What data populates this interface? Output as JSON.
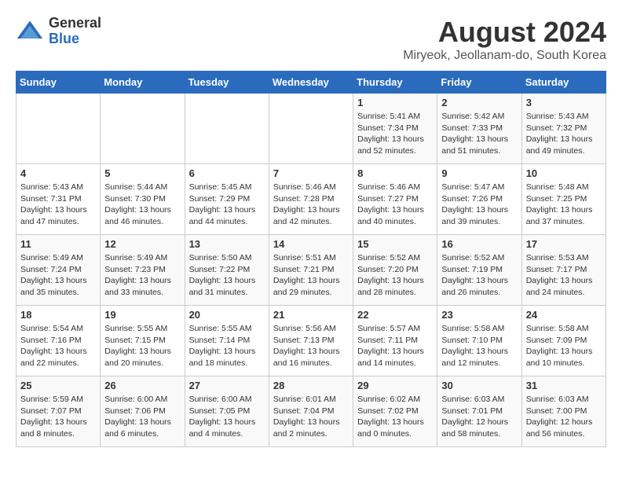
{
  "logo": {
    "general": "General",
    "blue": "Blue"
  },
  "title": "August 2024",
  "location": "Miryeok, Jeollanam-do, South Korea",
  "headers": [
    "Sunday",
    "Monday",
    "Tuesday",
    "Wednesday",
    "Thursday",
    "Friday",
    "Saturday"
  ],
  "weeks": [
    [
      {
        "day": "",
        "info": ""
      },
      {
        "day": "",
        "info": ""
      },
      {
        "day": "",
        "info": ""
      },
      {
        "day": "",
        "info": ""
      },
      {
        "day": "1",
        "info": "Sunrise: 5:41 AM\nSunset: 7:34 PM\nDaylight: 13 hours\nand 52 minutes."
      },
      {
        "day": "2",
        "info": "Sunrise: 5:42 AM\nSunset: 7:33 PM\nDaylight: 13 hours\nand 51 minutes."
      },
      {
        "day": "3",
        "info": "Sunrise: 5:43 AM\nSunset: 7:32 PM\nDaylight: 13 hours\nand 49 minutes."
      }
    ],
    [
      {
        "day": "4",
        "info": "Sunrise: 5:43 AM\nSunset: 7:31 PM\nDaylight: 13 hours\nand 47 minutes."
      },
      {
        "day": "5",
        "info": "Sunrise: 5:44 AM\nSunset: 7:30 PM\nDaylight: 13 hours\nand 46 minutes."
      },
      {
        "day": "6",
        "info": "Sunrise: 5:45 AM\nSunset: 7:29 PM\nDaylight: 13 hours\nand 44 minutes."
      },
      {
        "day": "7",
        "info": "Sunrise: 5:46 AM\nSunset: 7:28 PM\nDaylight: 13 hours\nand 42 minutes."
      },
      {
        "day": "8",
        "info": "Sunrise: 5:46 AM\nSunset: 7:27 PM\nDaylight: 13 hours\nand 40 minutes."
      },
      {
        "day": "9",
        "info": "Sunrise: 5:47 AM\nSunset: 7:26 PM\nDaylight: 13 hours\nand 39 minutes."
      },
      {
        "day": "10",
        "info": "Sunrise: 5:48 AM\nSunset: 7:25 PM\nDaylight: 13 hours\nand 37 minutes."
      }
    ],
    [
      {
        "day": "11",
        "info": "Sunrise: 5:49 AM\nSunset: 7:24 PM\nDaylight: 13 hours\nand 35 minutes."
      },
      {
        "day": "12",
        "info": "Sunrise: 5:49 AM\nSunset: 7:23 PM\nDaylight: 13 hours\nand 33 minutes."
      },
      {
        "day": "13",
        "info": "Sunrise: 5:50 AM\nSunset: 7:22 PM\nDaylight: 13 hours\nand 31 minutes."
      },
      {
        "day": "14",
        "info": "Sunrise: 5:51 AM\nSunset: 7:21 PM\nDaylight: 13 hours\nand 29 minutes."
      },
      {
        "day": "15",
        "info": "Sunrise: 5:52 AM\nSunset: 7:20 PM\nDaylight: 13 hours\nand 28 minutes."
      },
      {
        "day": "16",
        "info": "Sunrise: 5:52 AM\nSunset: 7:19 PM\nDaylight: 13 hours\nand 26 minutes."
      },
      {
        "day": "17",
        "info": "Sunrise: 5:53 AM\nSunset: 7:17 PM\nDaylight: 13 hours\nand 24 minutes."
      }
    ],
    [
      {
        "day": "18",
        "info": "Sunrise: 5:54 AM\nSunset: 7:16 PM\nDaylight: 13 hours\nand 22 minutes."
      },
      {
        "day": "19",
        "info": "Sunrise: 5:55 AM\nSunset: 7:15 PM\nDaylight: 13 hours\nand 20 minutes."
      },
      {
        "day": "20",
        "info": "Sunrise: 5:55 AM\nSunset: 7:14 PM\nDaylight: 13 hours\nand 18 minutes."
      },
      {
        "day": "21",
        "info": "Sunrise: 5:56 AM\nSunset: 7:13 PM\nDaylight: 13 hours\nand 16 minutes."
      },
      {
        "day": "22",
        "info": "Sunrise: 5:57 AM\nSunset: 7:11 PM\nDaylight: 13 hours\nand 14 minutes."
      },
      {
        "day": "23",
        "info": "Sunrise: 5:58 AM\nSunset: 7:10 PM\nDaylight: 13 hours\nand 12 minutes."
      },
      {
        "day": "24",
        "info": "Sunrise: 5:58 AM\nSunset: 7:09 PM\nDaylight: 13 hours\nand 10 minutes."
      }
    ],
    [
      {
        "day": "25",
        "info": "Sunrise: 5:59 AM\nSunset: 7:07 PM\nDaylight: 13 hours\nand 8 minutes."
      },
      {
        "day": "26",
        "info": "Sunrise: 6:00 AM\nSunset: 7:06 PM\nDaylight: 13 hours\nand 6 minutes."
      },
      {
        "day": "27",
        "info": "Sunrise: 6:00 AM\nSunset: 7:05 PM\nDaylight: 13 hours\nand 4 minutes."
      },
      {
        "day": "28",
        "info": "Sunrise: 6:01 AM\nSunset: 7:04 PM\nDaylight: 13 hours\nand 2 minutes."
      },
      {
        "day": "29",
        "info": "Sunrise: 6:02 AM\nSunset: 7:02 PM\nDaylight: 13 hours\nand 0 minutes."
      },
      {
        "day": "30",
        "info": "Sunrise: 6:03 AM\nSunset: 7:01 PM\nDaylight: 12 hours\nand 58 minutes."
      },
      {
        "day": "31",
        "info": "Sunrise: 6:03 AM\nSunset: 7:00 PM\nDaylight: 12 hours\nand 56 minutes."
      }
    ]
  ]
}
